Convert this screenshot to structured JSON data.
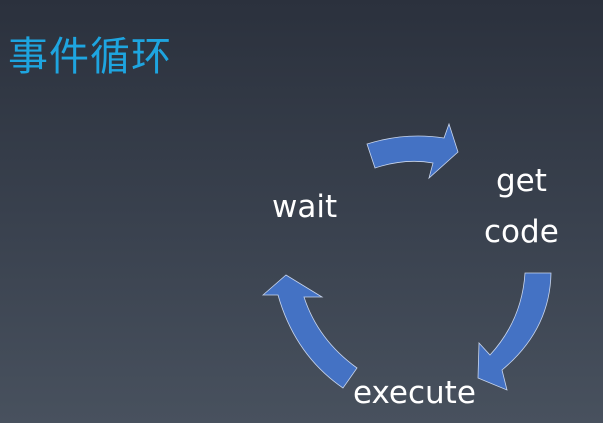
{
  "slide": {
    "title": "事件循环",
    "arrow_color": "#4472c4",
    "cycle": [
      "wait",
      "get",
      "code",
      "execute"
    ]
  }
}
